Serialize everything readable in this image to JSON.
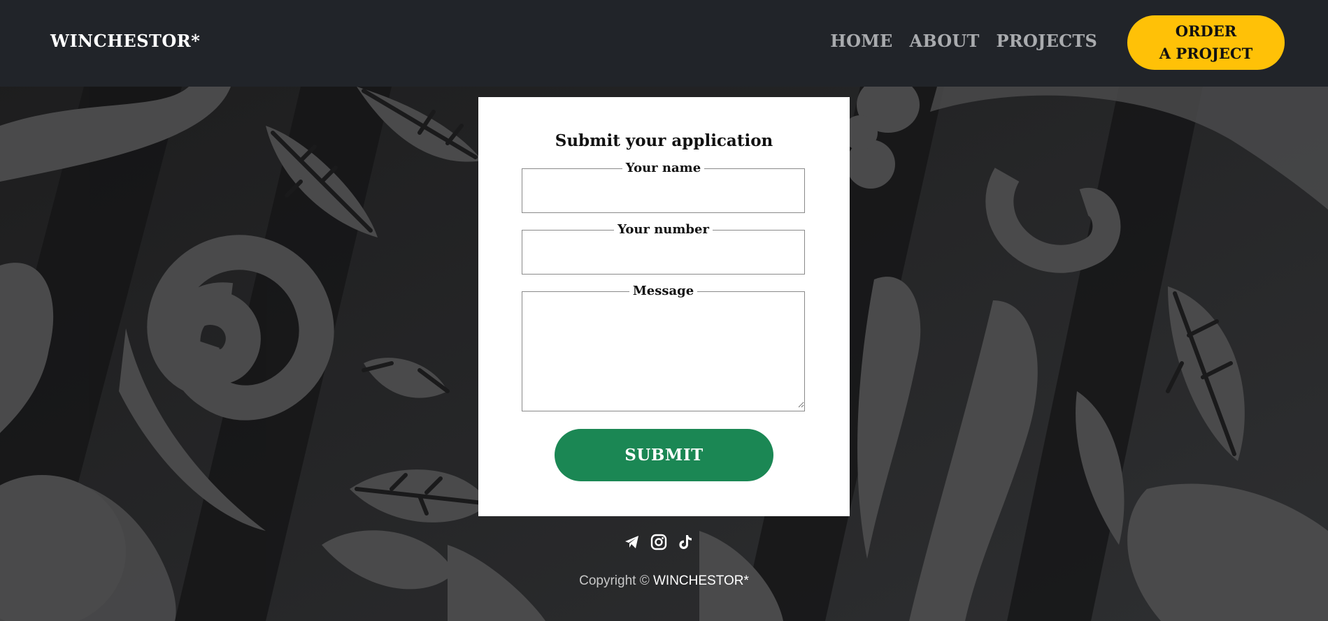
{
  "header": {
    "brand": "WINCHESTOR*",
    "nav": [
      "HOME",
      "ABOUT",
      "PROJECTS"
    ],
    "order_line1": "ORDER",
    "order_line2": "A PROJECT"
  },
  "form": {
    "title": "Submit your application",
    "name_label": "Your name",
    "number_label": "Your number",
    "message_label": "Message",
    "name_value": "",
    "number_value": "",
    "message_value": "",
    "submit_label": "SUBMIT"
  },
  "footer": {
    "socials": [
      "telegram-icon",
      "instagram-icon",
      "tiktok-icon"
    ],
    "copyright_prefix": "Copyright ©",
    "copyright_name": "WINCHESTOR*"
  },
  "colors": {
    "header_bg": "#212429",
    "accent_yellow": "#ffc107",
    "submit_green": "#1b8754",
    "nav_text": "#a9abae"
  }
}
